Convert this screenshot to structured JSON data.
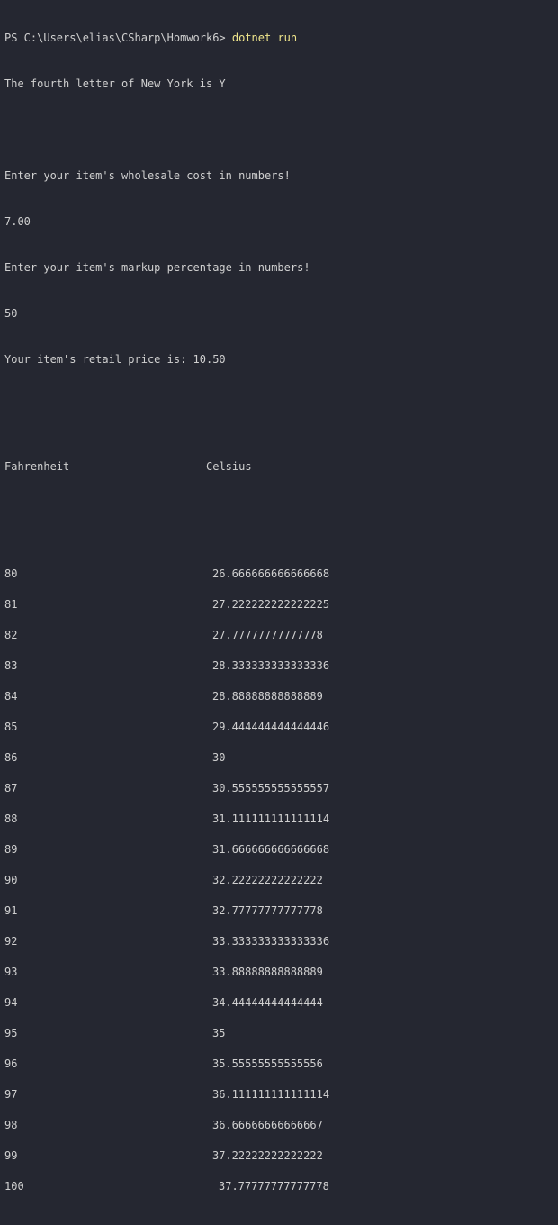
{
  "prompt": {
    "path": "PS C:\\Users\\elias\\CSharp\\Homwork6> ",
    "command": "dotnet run"
  },
  "output": {
    "letter_line": "The fourth letter of New York is Y",
    "wholesale_prompt": "Enter your item's wholesale cost in numbers!",
    "wholesale_value": "7.00",
    "markup_prompt": "Enter your item's markup percentage in numbers!",
    "markup_value": "50",
    "retail_line": "Your item's retail price is: 10.50"
  },
  "table": {
    "header_f": "Fahrenheit",
    "header_c": "Celsius",
    "sep_f": "----------",
    "sep_c": "-------",
    "rows": [
      {
        "f": "80",
        "c": "26.666666666666668"
      },
      {
        "f": "81",
        "c": "27.222222222222225"
      },
      {
        "f": "82",
        "c": "27.77777777777778"
      },
      {
        "f": "83",
        "c": "28.333333333333336"
      },
      {
        "f": "84",
        "c": "28.88888888888889"
      },
      {
        "f": "85",
        "c": "29.444444444444446"
      },
      {
        "f": "86",
        "c": "30"
      },
      {
        "f": "87",
        "c": "30.555555555555557"
      },
      {
        "f": "88",
        "c": "31.111111111111114"
      },
      {
        "f": "89",
        "c": "31.666666666666668"
      },
      {
        "f": "90",
        "c": "32.22222222222222"
      },
      {
        "f": "91",
        "c": "32.77777777777778"
      },
      {
        "f": "92",
        "c": "33.333333333333336"
      },
      {
        "f": "93",
        "c": "33.88888888888889"
      },
      {
        "f": "94",
        "c": "34.44444444444444"
      },
      {
        "f": "95",
        "c": "35"
      },
      {
        "f": "96",
        "c": "35.55555555555556"
      },
      {
        "f": "97",
        "c": "36.111111111111114"
      },
      {
        "f": "98",
        "c": "36.66666666666667"
      },
      {
        "f": "99",
        "c": "37.22222222222222"
      },
      {
        "f": "100",
        "c": "37.77777777777778"
      }
    ]
  }
}
